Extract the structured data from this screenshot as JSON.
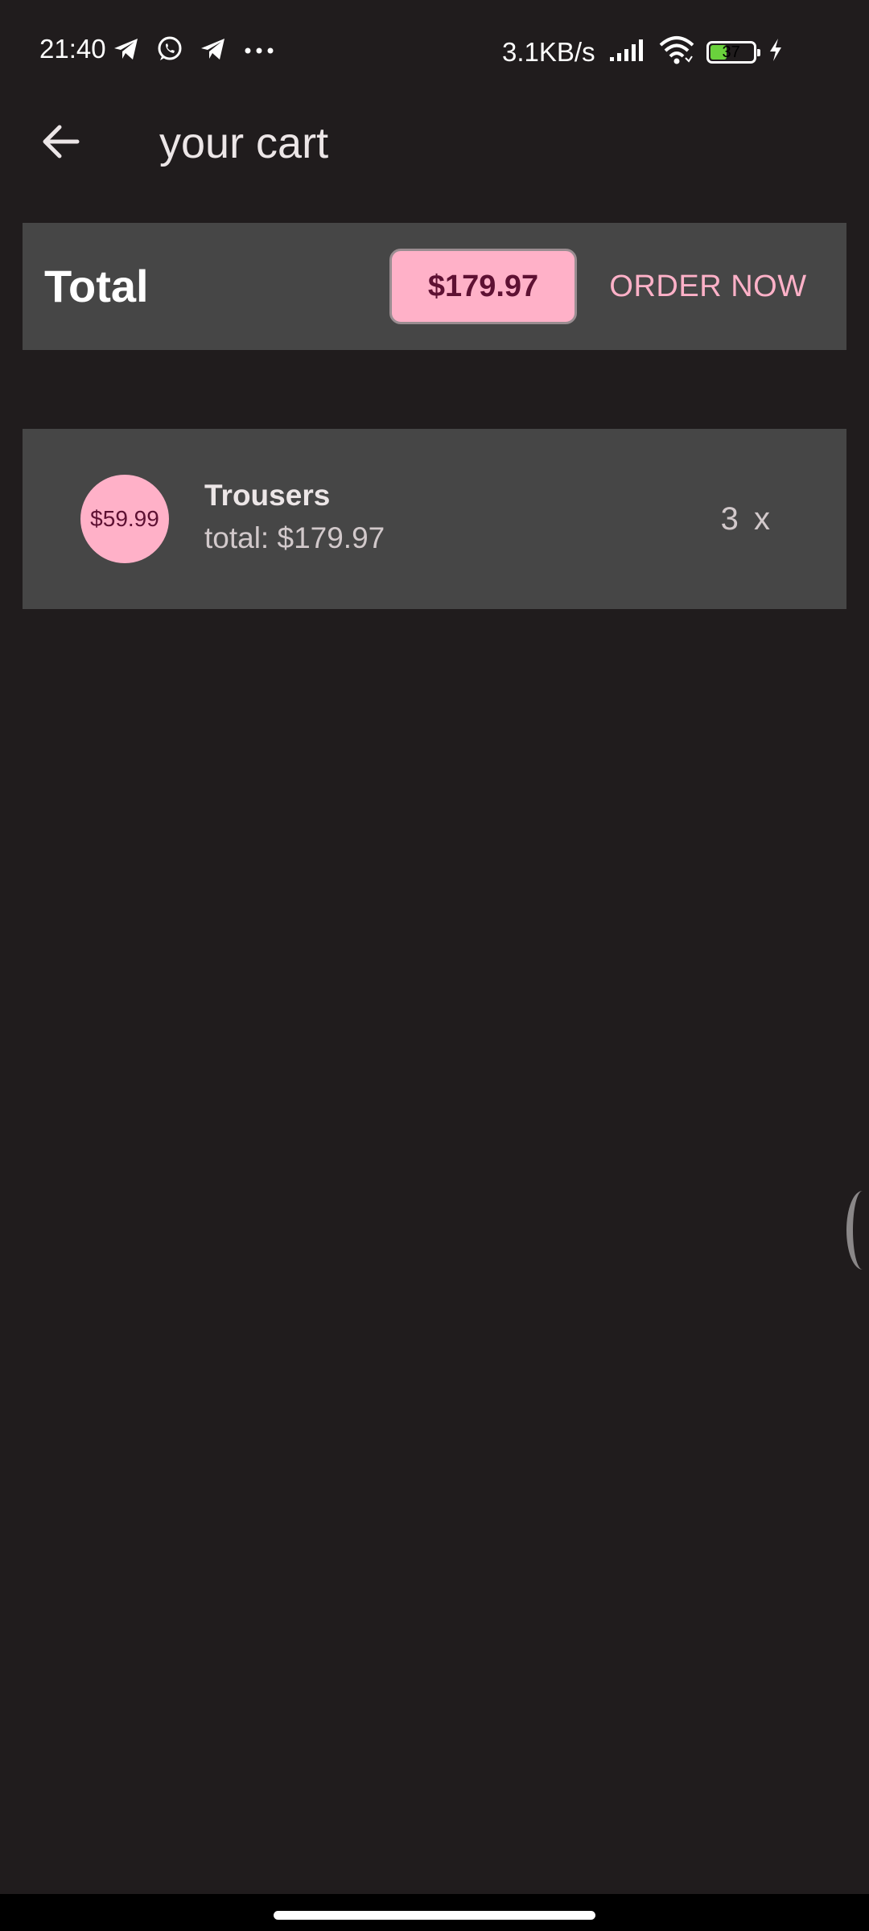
{
  "status_bar": {
    "time": "21:40",
    "network_speed": "3.1KB/s",
    "battery_level": "37",
    "battery_fraction": 0.37,
    "notification_icons": [
      "telegram-icon",
      "whatsapp-icon",
      "telegram-icon",
      "more-dots-icon"
    ],
    "system_icons": [
      "signal-icon",
      "wifi-icon",
      "battery-icon",
      "charging-icon"
    ]
  },
  "app_bar": {
    "back_icon": "arrow-left-icon",
    "title": "your cart"
  },
  "total_card": {
    "label": "Total",
    "amount": "$179.97",
    "order_button": "ORDER NOW"
  },
  "cart_items": [
    {
      "price": "$59.99",
      "name": "Trousers",
      "total": "total: $179.97",
      "quantity": "3 x"
    }
  ],
  "colors": {
    "background": "#201c1d",
    "card": "#464646",
    "accent": "#ffb1c8",
    "accent_text": "#5e1133"
  }
}
